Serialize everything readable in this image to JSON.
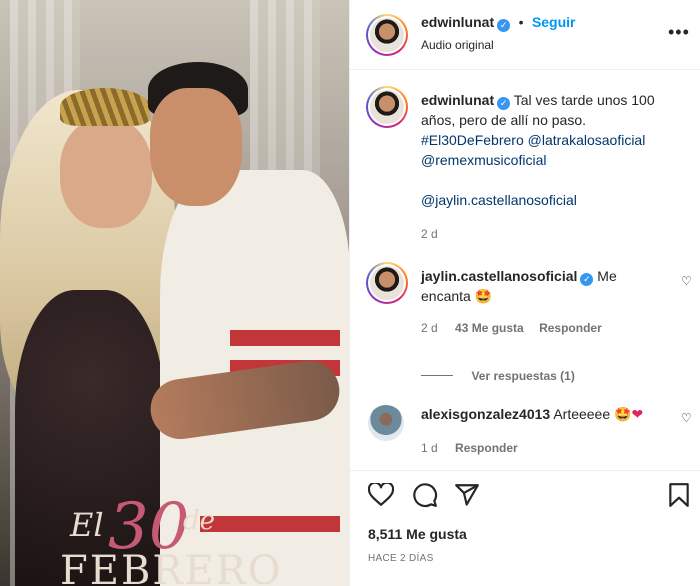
{
  "post": {
    "image_overlay": {
      "el": "El",
      "num": "30",
      "de": "de",
      "month": "FEBRERO"
    }
  },
  "header": {
    "username": "edwinlunat",
    "dot": "•",
    "follow_label": "Seguir",
    "subtitle": "Audio original",
    "more_icon": "more-horizontal-icon"
  },
  "caption": {
    "username": "edwinlunat",
    "text_line1": "Tal ves tarde unos 100",
    "text_line2": "años, pero de allí no paso.",
    "hashtag": "#El30DeFebrero",
    "mention1": "@latrakalosaoficial",
    "mention2": "@remexmusicoficial",
    "mention3": "@jaylin.castellanosoficial",
    "time": "2 d"
  },
  "comments": [
    {
      "username": "jaylin.castellanosoficial",
      "text_a": "Me",
      "text_b": "encanta",
      "emoji": "🤩",
      "time": "2 d",
      "likes": "43 Me gusta",
      "reply": "Responder",
      "view_replies": "Ver respuestas (1)"
    },
    {
      "username": "alexisgonzalez4013",
      "text": "Arteeeee",
      "emoji": "🤩❤",
      "time": "1 d",
      "reply": "Responder"
    }
  ],
  "actions": {
    "likes": "8,511 Me gusta",
    "posted": "HACE 2 DÍAS"
  },
  "colors": {
    "accent": "#0095f6",
    "verified": "#3797f0",
    "link": "#00376b",
    "muted": "#737373"
  }
}
